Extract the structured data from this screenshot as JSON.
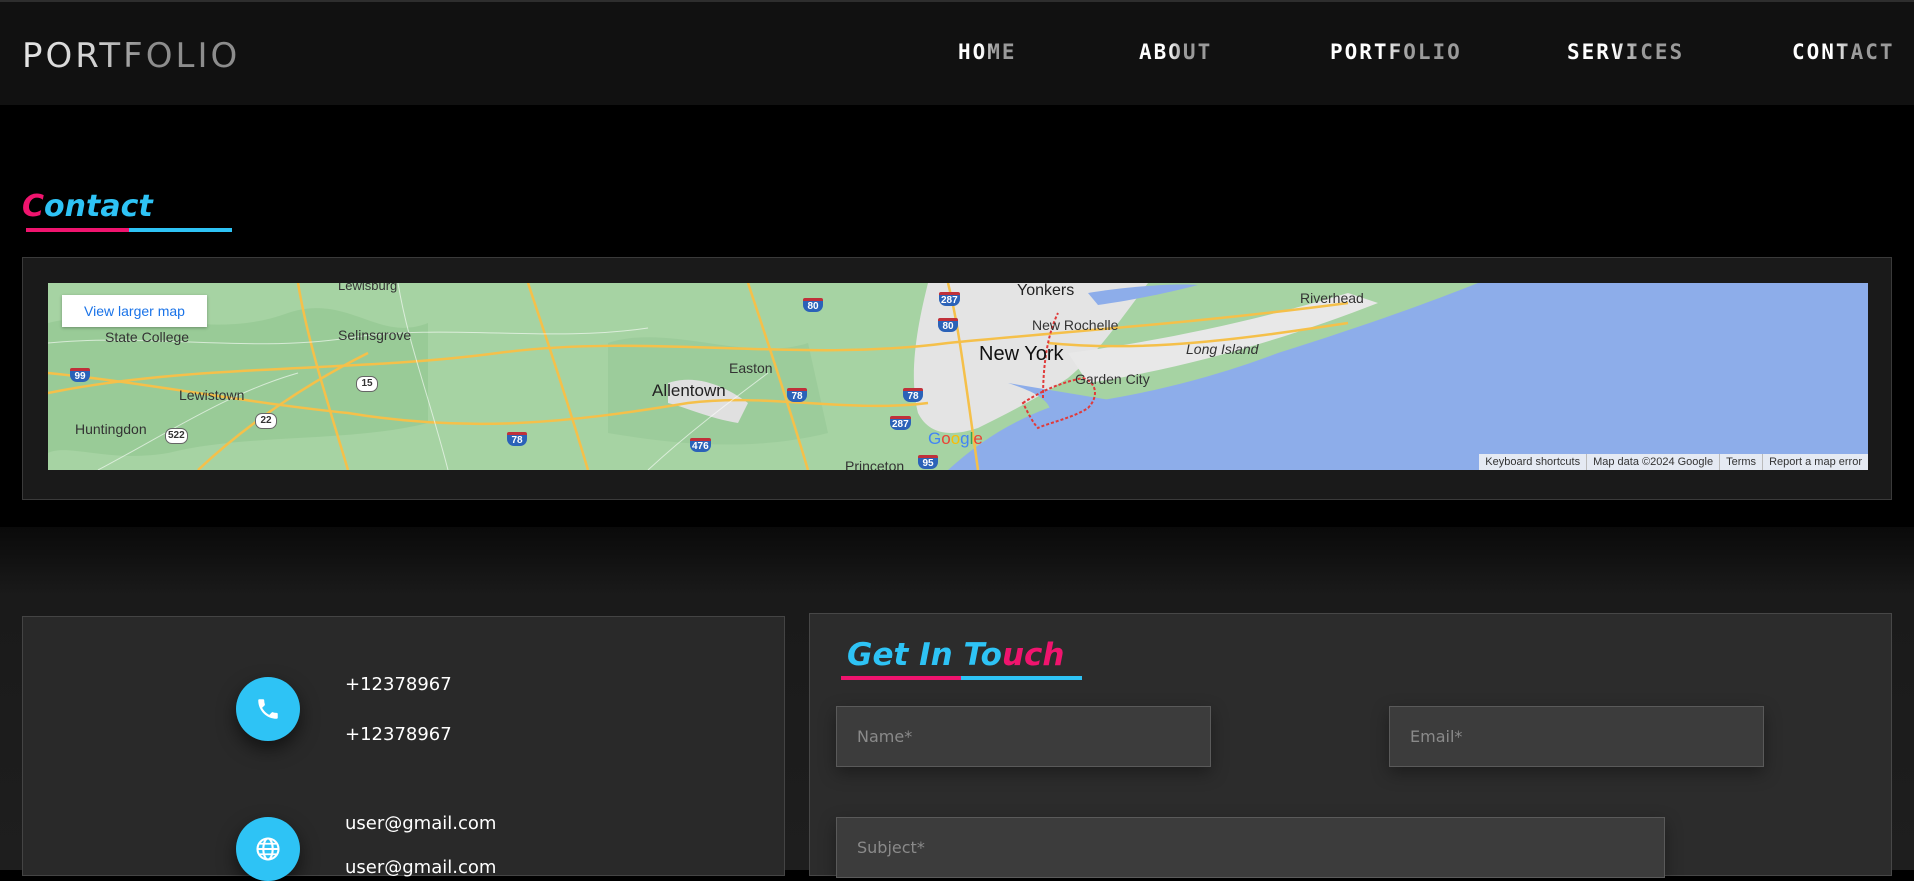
{
  "brand": {
    "logo": "PORTFOLIO"
  },
  "nav": {
    "home": "HOME",
    "about": "ABOUT",
    "portfolio": "PORTFOLIO",
    "services": "SERVICES",
    "contact": "CONTACT"
  },
  "contact_section": {
    "title_first_letter": "C",
    "title_rest": "ontact"
  },
  "map": {
    "view_larger": "View larger map",
    "places": {
      "lewisburg": "Lewisburg",
      "state_college": "State College",
      "selinsgrove": "Selinsgrove",
      "lewistown": "Lewistown",
      "huntingdon": "Huntingdon",
      "allentown": "Allentown",
      "easton": "Easton",
      "princeton": "Princeton",
      "yonkers": "Yonkers",
      "new_rochelle": "New Rochelle",
      "new_york": "New York",
      "garden_city": "Garden City",
      "long_island": "Long Island",
      "riverhead": "Riverhead"
    },
    "shields": [
      "99",
      "15",
      "22",
      "522",
      "78",
      "78",
      "78",
      "80",
      "80",
      "287",
      "287",
      "476",
      "95"
    ],
    "google": [
      "G",
      "o",
      "o",
      "g",
      "l",
      "e"
    ],
    "footer": {
      "shortcuts": "Keyboard shortcuts",
      "data": "Map data ©2024 Google",
      "terms": "Terms",
      "report": "Report a map error"
    },
    "colors": {
      "water": "#8dadea",
      "land": "#a6d3a3",
      "urban": "#e4e4e4",
      "highway": "#f5c04a"
    }
  },
  "contact_info": {
    "phone_1": "+12378967",
    "phone_2": "+12378967",
    "email_1": "user@gmail.com",
    "email_2": "user@gmail.com"
  },
  "form": {
    "title_part1": "Get In To",
    "title_part2": "uch",
    "name_placeholder": "Name*",
    "email_placeholder": "Email*",
    "subject_placeholder": "Subject*"
  },
  "colors": {
    "accent_blue": "#2ec3f5",
    "accent_pink": "#f0146e"
  }
}
